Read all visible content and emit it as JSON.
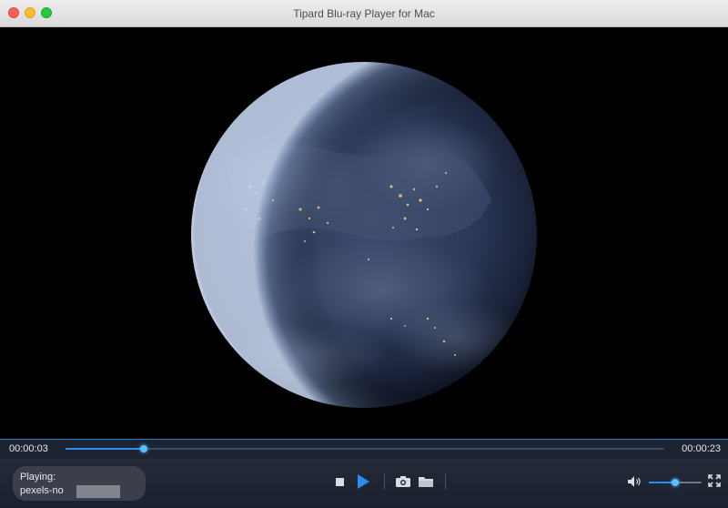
{
  "window": {
    "title": "Tipard Blu-ray Player for Mac"
  },
  "player": {
    "elapsed": "00:00:03",
    "duration": "00:00:23",
    "progress_fraction": 0.13,
    "now_playing_label": "Playing:",
    "now_playing_file": "pexels-no",
    "volume_fraction": 0.5
  },
  "icons": {
    "stop": "stop-icon",
    "play": "play-icon",
    "snapshot": "camera-icon",
    "open": "folder-icon",
    "volume": "speaker-icon",
    "fullscreen": "fullscreen-icon"
  },
  "colors": {
    "accent": "#2d8cf0",
    "control_bg": "#1f2533"
  }
}
